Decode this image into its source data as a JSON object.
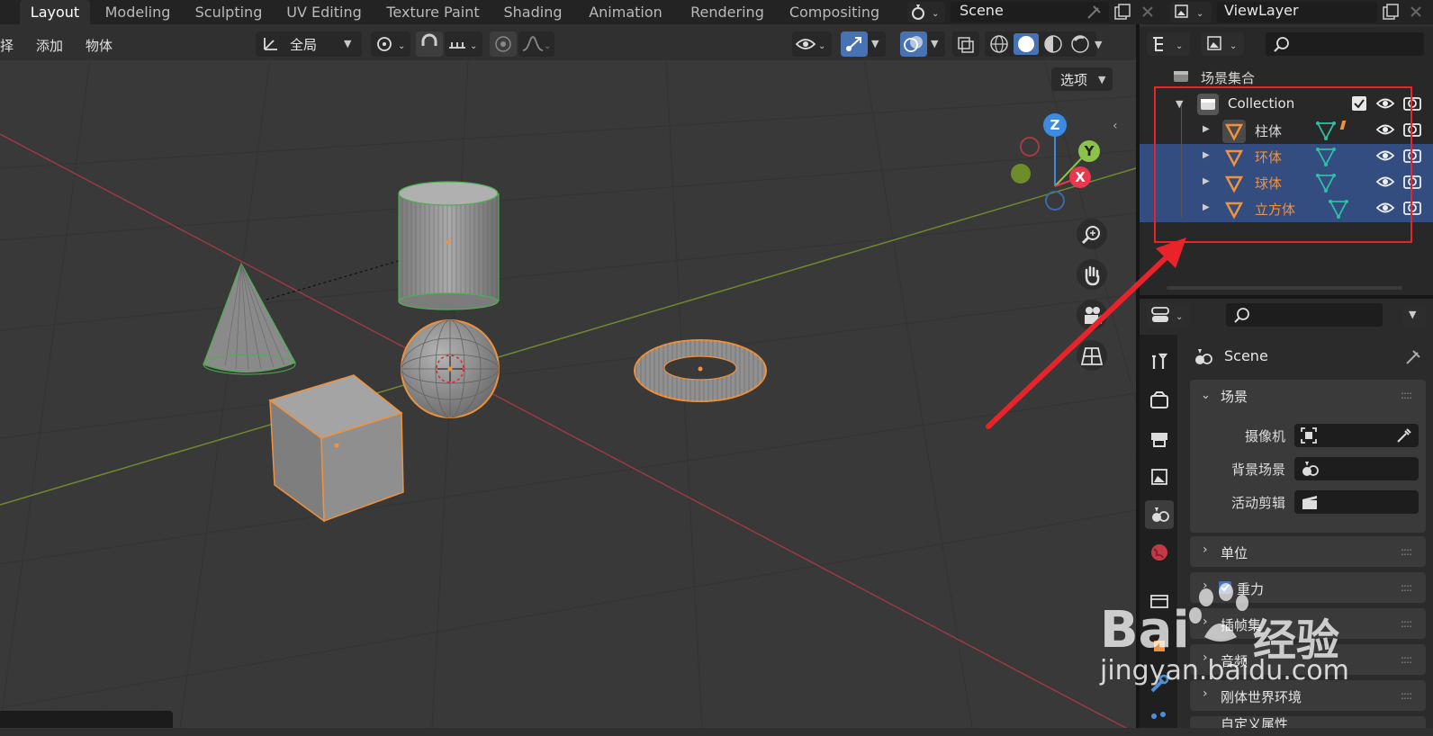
{
  "workspace_tabs": [
    {
      "label": "Layout",
      "active": true
    },
    {
      "label": "Modeling"
    },
    {
      "label": "Sculpting"
    },
    {
      "label": "UV Editing"
    },
    {
      "label": "Texture Paint"
    },
    {
      "label": "Shading"
    },
    {
      "label": "Animation"
    },
    {
      "label": "Rendering"
    },
    {
      "label": "Compositing"
    }
  ],
  "scene_selector": {
    "value": "Scene"
  },
  "view_layer_selector": {
    "value": "ViewLayer"
  },
  "viewport_menu": {
    "select": "择",
    "add": "添加",
    "object": "物体"
  },
  "transform_orientation": {
    "value": "全局"
  },
  "options_button": {
    "label": "选项"
  },
  "gizmo": {
    "z": "Z",
    "y": "Y",
    "x": "X"
  },
  "outliner": {
    "root_label": "场景集合",
    "collection_label": "Collection",
    "items": [
      {
        "label": "柱体",
        "selected": false,
        "color": "#dcdcdc"
      },
      {
        "label": "环体",
        "selected": true,
        "color": "#f0913c"
      },
      {
        "label": "球体",
        "selected": true,
        "color": "#f0913c"
      },
      {
        "label": "立方体",
        "selected": true,
        "color": "#f0913c"
      }
    ]
  },
  "properties": {
    "header_title": "Scene",
    "scene_panel": {
      "title": "场景",
      "camera_label": "摄像机",
      "background_label": "背景场景",
      "active_clip_label": "活动剪辑"
    },
    "collapsed_panels": [
      "单位",
      "重力",
      "插帧集",
      "音频",
      "刚体世界环境",
      "自定义属性"
    ]
  },
  "watermark": {
    "brand": "Bai",
    "brand2": "经验",
    "url": "jingyan.baidu.com"
  },
  "colors": {
    "accent": "#4772b3",
    "selection_orange": "#f0913c",
    "annotation_red": "#e8232a",
    "axis_x": "#e8374e",
    "axis_y": "#8bc34a",
    "axis_z": "#3d8be0"
  }
}
